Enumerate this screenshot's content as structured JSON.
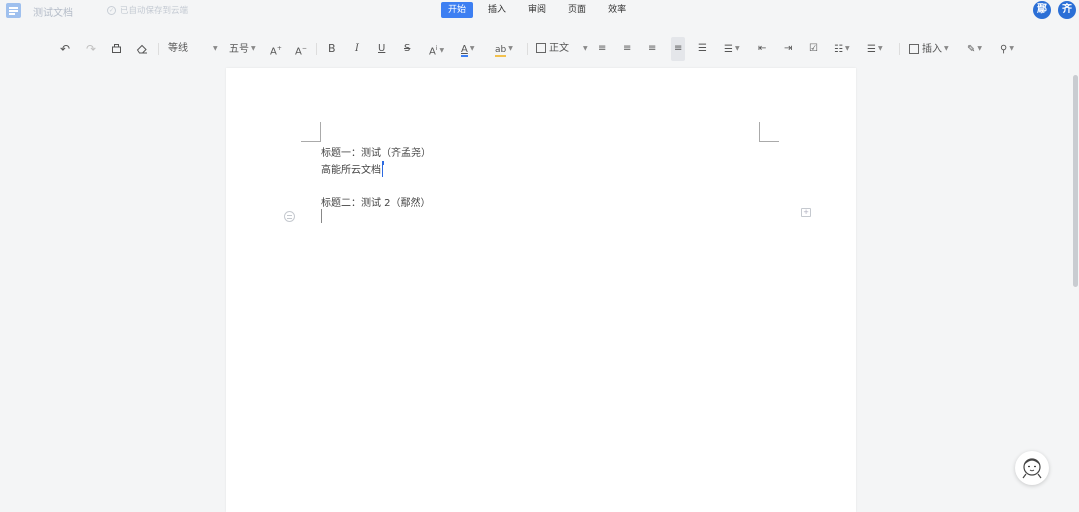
{
  "header": {
    "doc_title": "测试文档",
    "save_status": "已自动保存到云端",
    "tabs": [
      {
        "label": "开始",
        "active": true
      },
      {
        "label": "插入",
        "active": false
      },
      {
        "label": "审阅",
        "active": false
      },
      {
        "label": "页面",
        "active": false
      },
      {
        "label": "效率",
        "active": false
      }
    ],
    "collaborators": [
      {
        "initial": "鄢",
        "color": "#2b6fd6"
      },
      {
        "initial": "齐",
        "color": "#2b6fd6"
      }
    ]
  },
  "toolbar": {
    "font_name": "等线",
    "font_size": "五号",
    "style_name": "正文",
    "insert_label": "插入"
  },
  "document": {
    "heading1": "标题一：测试（齐孟尧）",
    "body1": "高能所云文档",
    "heading2": "标题二：测试 2（鄢然）"
  },
  "presence": {
    "cursor_user_initial": "齐"
  },
  "colors": {
    "accent": "#3d7ff2",
    "font_color_underline": "#3d7ff2",
    "highlight_underline": "#f2c14e"
  }
}
